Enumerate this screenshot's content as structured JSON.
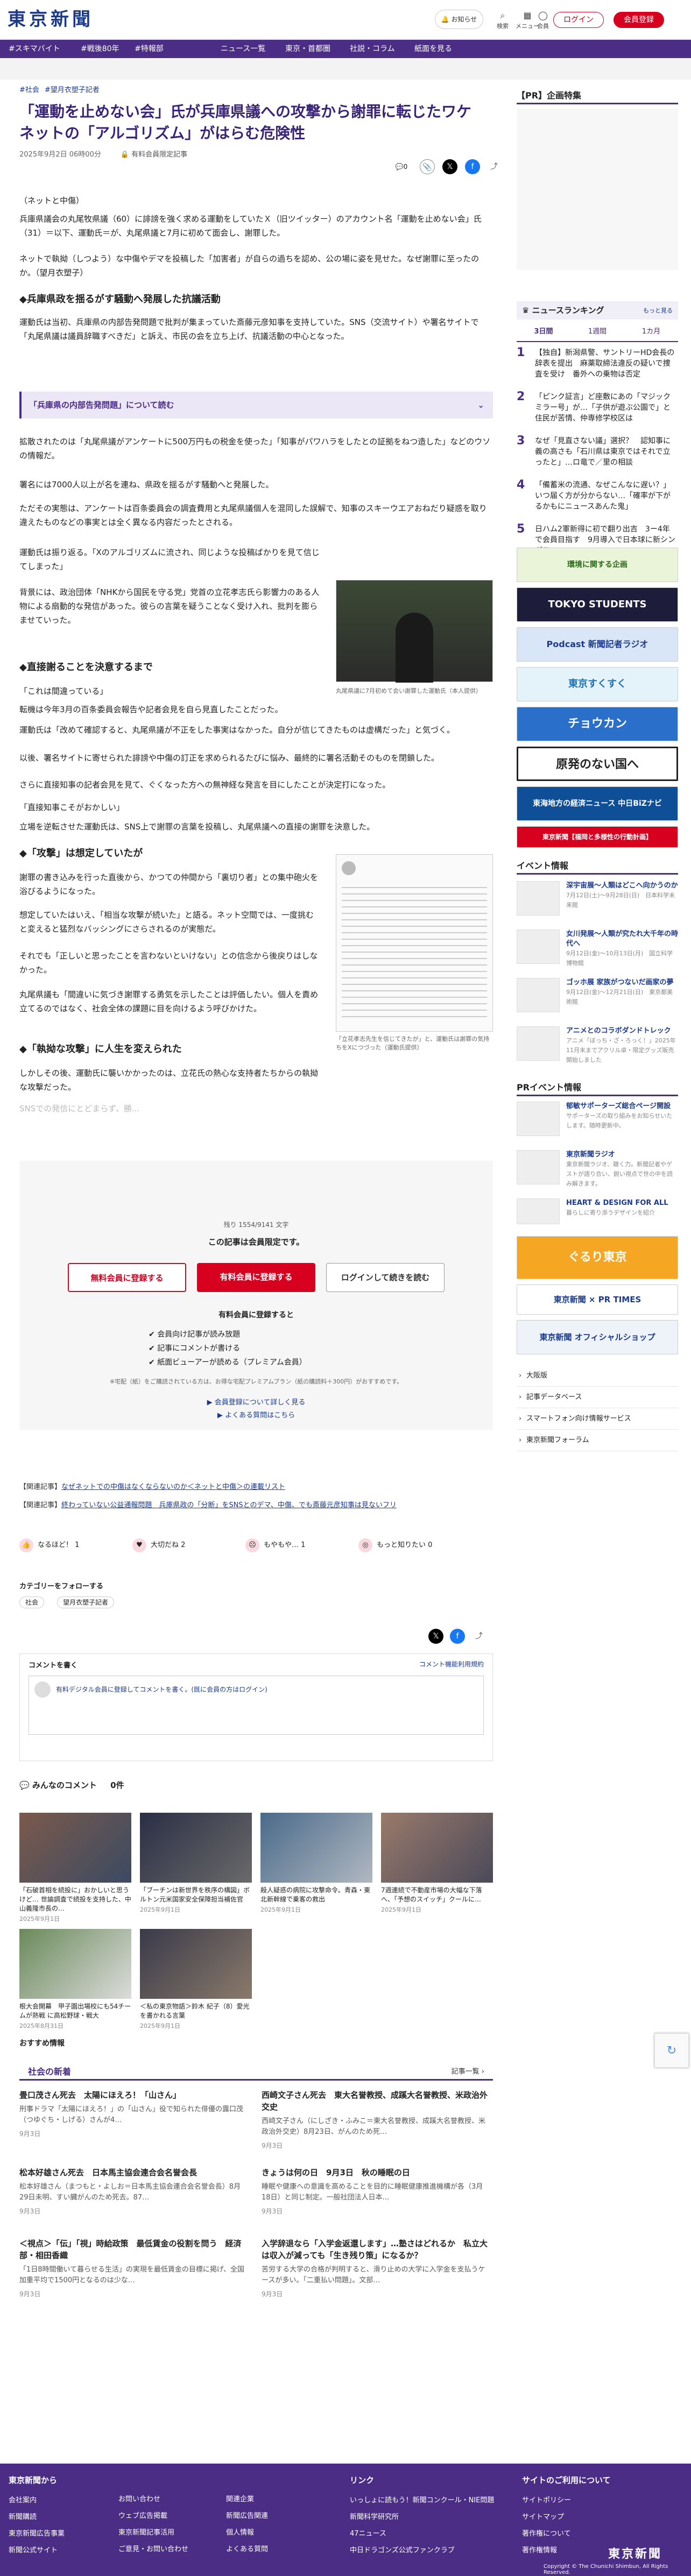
{
  "header": {
    "logo": "東京新聞",
    "news_btn": "お知らせ",
    "icons": [
      {
        "name": "search-icon",
        "glyph": "⌕",
        "label": "検索"
      },
      {
        "name": "grid-icon",
        "glyph": "▦",
        "label": "メニュー"
      },
      {
        "name": "user-icon",
        "glyph": "◯",
        "label": "会員"
      }
    ],
    "login": "ログイン",
    "register": "会員登録"
  },
  "nav": [
    "#スキマバイト",
    "#戦後80年",
    "#特報部",
    "ニュース一覧",
    "東京・首都圏",
    "社説・コラム",
    "紙面を見る"
  ],
  "crumbs": [
    "#社会",
    "#望月衣塑子記者"
  ],
  "article": {
    "title": "「運動を止めない会」氏が兵庫県議への攻撃から謝罪に転じたワケ　ネットの「アルゴリズム」がはらむ危険性",
    "date": "2025年9月2日 06時00分",
    "tag": "有料会員限定記事",
    "comments": "0",
    "source": "（ネットと中傷）",
    "p1": "兵庫県議会の丸尾牧県議（60）に誹謗を強く求める運動をしていたＸ（旧ツイッター）のアカウント名「運動を止めない会」氏（31）＝以下、運動氏＝が、丸尾県議と7月に初めて面会し、謝罪した。",
    "p2": "ネットで執拗（しつよう）な中傷やデマを投稿した「加害者」が自らの過ちを認め、公の場に姿を見せた。なぜ謝罪に至ったのか。（望月衣塑子）",
    "h1": "◆兵庫県政を揺るがす騒動へ発展した抗議活動",
    "p3": "運動氏は当初、兵庫県の内部告発問題で批判が集まっていた斎藤元彦知事を支持していた。SNS（交流サイト）や署名サイトで「丸尾県議は議員辞職すべきだ」と訴え、市民の会を立ち上げ、抗議活動の中心となった。",
    "related_box": "「兵庫県の内部告発問題」について読む",
    "p4": "拡散されたのは「丸尾県議がアンケートに500万円もの税金を使った」「知事がパワハラをしたとの証拠をねつ造した」などのウソの情報だ。",
    "p5": "署名には7000人以上が名を連ね、県政を揺るがす騒動へと発展した。",
    "p6": "ただその実態は、アンケートは百条委員会の調査費用と丸尾県議個人を混同した誤解で、知事のスキーウエアおねだり疑惑を取り違えたものなどの事実とは全く異なる内容だったとされる。",
    "p7": "運動氏は振り返る。「Xのアルゴリズムに流され、同じような投稿ばかりを見て信じてしまった」",
    "p8": "背景には、政治団体「NHKから国民を守る党」党首の立花孝志氏ら影響力のある人物による扇動的な発信があった。彼らの言葉を疑うことなく受け入れ、批判を膨らませていった。",
    "photo1_caption": "丸尾県議に7月初めて会い謝罪した運動氏（本人提供）",
    "h2": "◆直接謝ることを決意するまで",
    "p9": "「これは間違っている」",
    "p10": "転機は今年3月の百条委員会報告や記者会見を自ら見直したことだった。",
    "p11": "運動氏は「改めて確認すると、丸尾県議が不正をした事実はなかった。自分が信じてきたものは虚構だった」と気づく。",
    "p12": "以後、署名サイトに寄せられた誹謗や中傷の訂正を求められるたびに悩み、最終的に署名活動そのものを閉鎖した。",
    "p13": "さらに直接知事の記者会見を見て、ぐくなった方への無神経な発言を目にしたことが決定打になった。",
    "p14": "「直接知事こそがおかしい」",
    "p15": "立場を逆転させた運動氏は、SNS上で謝罪の言葉を投稿し、丸尾県議への直接の謝罪を決意した。",
    "h3": "◆「攻撃」は想定していたが",
    "p16": "謝罪の書き込みを行った直後から、かつての仲間から「裏切り者」との集中砲火を浴びるようになった。",
    "p17": "想定していたはいえ、「相当な攻撃が続いた」と語る。ネット空間では、一度挑むと変えると猛烈なバッシングにさらされるのが実態だ。",
    "p18": "それでも「正しいと思ったことを言わないといけない」との信念から後戻りはしなかった。",
    "p19": "丸尾県議も「間違いに気づき謝罪する勇気を示したことは評価したい。個人を責め立てるのではなく、社会全体の課題に目を向けるよう呼びかけた。",
    "photo2_caption": "「立花孝志先生を信じてきたが」と、運動氏は謝罪の気持ちをXにつづった（運動氏提供）",
    "h4": "◆「執拗な攻撃」に人生を変えられた",
    "p20": "しかしその後、運動氏に襲いかかったのは、立花氏の熱心な支持者たちからの執拗な攻撃だった。",
    "fade": "SNSでの発信にとどまらず、勝..."
  },
  "paywall": {
    "remaining": "残り 1554/9141 文字",
    "members_only": "この記事は会員限定です。",
    "btn_free": "無料会員に登録する",
    "btn_paid": "有料会員に登録する",
    "btn_login": "ログインして続きを読む",
    "benefit_title": "有料会員に登録すると",
    "benefits": [
      "会員向け記事が読み放題",
      "記事にコメントが書ける",
      "紙面ビューアーが読める（プレミアム会員）"
    ],
    "note": "※宅配（紙）をご購読されている方は、お得な宅配プレミアムプラン（紙の購読料＋300円）がおすすめです。",
    "link1": "会員登録について詳しく見る",
    "link2": "よくある質問はこちら"
  },
  "feedback": [
    {
      "label": "【関連記事】",
      "text": "なぜネットでの中傷はなくならないのか＜ネットと中傷＞の連載リスト"
    },
    {
      "label": "【関連記事】",
      "text": "終わっていない公益通報問題　兵庫県政の「分断」をSNSとのデマ、中傷、でも斎藤元彦知事は見ないフリ"
    }
  ],
  "reactions": [
    {
      "icon": "thumb-icon",
      "glyph": "👍",
      "label": "なるほど！",
      "count": "1"
    },
    {
      "icon": "heart-icon",
      "glyph": "♥",
      "label": "大切だね",
      "count": "2"
    },
    {
      "icon": "sad-icon",
      "glyph": "☹",
      "label": "もやもや…",
      "count": "1"
    },
    {
      "icon": "more-icon",
      "glyph": "◎",
      "label": "もっと知りたい",
      "count": "0"
    }
  ],
  "follow": {
    "title": "カテゴリーをフォローする",
    "tags": [
      "社会",
      "望月衣塑子記者"
    ]
  },
  "comment": {
    "title": "コメントを書く",
    "rule_link": "コメント機能利用規約",
    "placeholder": "有料デジタル会員に登録してコメントを書く。(既に会員の方はログイン)"
  },
  "comment_list": {
    "title": "みんなのコメント",
    "count": "0件"
  },
  "related": [
    {
      "t": "「石破首相を続投に」おかしいと思うけど… 世論調査で続投を支持した、中山義隆市長の…",
      "d": "2025年9月1日"
    },
    {
      "t": "「ブーチンは新世界を秩序の構図」ボルトン元米国家安全保障担当補佐官",
      "d": "2025年9月1日"
    },
    {
      "t": "殺人疑惑の病院に攻撃命令。青森・東北新幹線で乗客の救出",
      "d": "2025年9月1日"
    },
    {
      "t": "7週連続で不動産市場の大幅な下落へ、「予想のスイッチ」クールに…",
      "d": "2025年9月1日"
    },
    {
      "t": "根大会開幕　甲子園出場校にも54チームが熱戦 に高松野球・戦大",
      "d": "2025年8月31日"
    },
    {
      "t": "＜私の東京物語＞鈴木 紀子（8）愛光を書かれる言葉",
      "d": "2025年9月1日"
    }
  ],
  "recommend": "おすすめ情報",
  "society": {
    "title": "社会の新着",
    "more": "記事一覧",
    "items": [
      {
        "t": "畳口茂さん死去　太陽にほえろ！「山さん」",
        "s": "刑事ドラマ「太陽にほえろ！」の「山さん」役で知られた俳優の露口茂（つゆぐち・しげる）さんが4…",
        "d": "9月3日"
      },
      {
        "t": "西崎文子さん死去　東大名誉教授、成蹊大名誉教授、米政治外交史",
        "s": "西崎文子さん（にしざき・ふみこ＝東大名誉教授、成蹊大名誉教授、米政治外交史）8月23日、がんのため死…",
        "d": "9月3日"
      },
      {
        "t": "松本好雄さん死去　日本馬主協会連合会名誉会長",
        "s": "松本好雄さん（まつもと・よしお＝日本馬主協会連合会名誉会長）8月29日未明、すい臓がんのため死去。87…",
        "d": "9月3日"
      },
      {
        "t": "きょうは何の日　9月3日　秋の睡眠の日",
        "s": "睡眠や健康への意識を高めることを目的に睡眠健康推進機構が各（3月18日）と同じ制定。一般社団法人日本…",
        "d": "9月3日"
      },
      {
        "t": "＜視点＞「伝」「視」時給政策　最低賃金の役割を問う　経済部・相田香織",
        "s": "「1日8時間働いて暮らせる生活」の実現を最低賃金の目標に掲げ、全国加重平均で1500円となるのは少な…",
        "d": "9月3日"
      },
      {
        "t": "入学辞退なら「入学金返還します」…塾さはどれるか　私立大は収入が減っても「生き残り策」になるか？",
        "s": "苦労する大学の合格が判明すると、滑り止めの大学に入学金を支払うケースが多い。「二重払い問題」。文部…",
        "d": "9月3日"
      }
    ]
  },
  "sidebar": {
    "pr_title": "【PR】企画特集",
    "ranking_title": "ニュースランキング",
    "ranking_more": "もっと見る",
    "ranking_tabs": [
      "3日間",
      "1週間",
      "1カ月"
    ],
    "ranking": [
      {
        "n": "1",
        "t": "【独自】新潟県警、サントリーHD会長の辞表を提出　麻薬取締法違反の疑いで捜査を受け　番外への乗物は否定"
      },
      {
        "n": "2",
        "t": "「ピンク証言」ど座敷にあの「マジックミラー号」が…「子供が遊ぶ公園で」と住民が苦情、仲専修学校区は"
      },
      {
        "n": "3",
        "t": "なぜ「見直さない議」選択？　認知事に義の高さも「石川県は東京ではそれで立ったと」…ロ竜で／里の相談"
      },
      {
        "n": "4",
        "t": "「備蓄米の流通、なぜこんなに遅い？」いつ届く方が分からない…「確率が下がるかもにニュースあんた鬼」"
      },
      {
        "n": "5",
        "t": "日ハム2軍新得に初で翻り出吉　3ー4年で会員目指す　9月導入で日本球に新シングル"
      }
    ],
    "banners": [
      {
        "name": "ad-kankyo",
        "t": "環境に関する企画",
        "bg": "#e9f4d8",
        "fg": "#2d6a1a"
      },
      {
        "name": "ad-students",
        "t": "TOKYO STUDENTS",
        "bg": "#1d1d3b",
        "fg": "#ffffff"
      },
      {
        "name": "ad-podcast",
        "t": "Podcast 新聞記者ラジオ",
        "bg": "#d9e6f7",
        "fg": "#1b3a8c"
      },
      {
        "name": "ad-tokyo-kurasu",
        "t": "東京すくすく",
        "bg": "#e4f2f9",
        "fg": "#1b6fb3"
      },
      {
        "name": "ad-chouchoukan",
        "t": "チョウカン",
        "bg": "#2a6fc9",
        "fg": "#ffffff"
      },
      {
        "name": "ad-genpatsu",
        "t": "原発のない国へ",
        "bg": "#ffffff",
        "fg": "#222222"
      },
      {
        "name": "ad-chunichi-biz",
        "t": "東海地方の経済ニュース 中日BiZナビ",
        "bg": "#0e4f97",
        "fg": "#ffffff"
      },
      {
        "name": "ad-shimbun-event",
        "t": "東京新聞【福岡と多様性の行動計画】",
        "bg": "#d7001f",
        "fg": "#ffffff"
      }
    ],
    "event_title": "イベント情報",
    "events": [
      {
        "t": "深宇宙展〜人類はどこへ向かうのか",
        "s": "7月12日(土)〜9月28日(日)　日本科学未来館"
      },
      {
        "t": "女川発展〜人類が究たれ大千年の時代へ",
        "s": "9月12日(金)〜10月13日(月)　国立科学博物館"
      },
      {
        "t": "ゴッホ展 家族がつないだ画家の夢",
        "s": "9月12日(金)〜12月21日(日)　東京都美術館"
      },
      {
        "t": "アニメとのコラボダンドトレック",
        "s": "アニメ「ぼっち・ざ・ろっく！」2025年11月末までアクリル卓・限定グッズ販売開始しました"
      }
    ],
    "prevent_title": "PRイベント情報",
    "prevents": [
      {
        "t": "郁敏サポーターズ総合ページ開設",
        "s": "サポーターズの取り組みをお知らせいたします。随時更新中。"
      },
      {
        "t": "東京新聞ラジオ",
        "s": "東京新聞ラジオ、聴く力。新聞記者やゲストが語り合い、鋭い視点で世の中を読み解きます。"
      },
      {
        "t": "HEART & DESIGN FOR ALL",
        "s": "暮らしに寄り添うデザインを紹介"
      }
    ],
    "shop": [
      "ぐるり東京",
      "東京新聞 × PR TIMES",
      "東京新聞 オフィシャルショップ"
    ],
    "links": [
      "大阪版",
      "記事データベース",
      "スマートフォン向け情報サービス",
      "東京新聞フォーラム"
    ]
  },
  "footer": {
    "col1_title": "東京新聞から",
    "col1": [
      "会社案内",
      "新聞購読",
      "東京新聞広告事業",
      "新聞公式サイト"
    ],
    "col2": [
      "お問い合わせ",
      "ウェブ広告掲載",
      "東京新聞記事活用",
      "ご意見・お問い合わせ"
    ],
    "col3": [
      "関連企業",
      "新聞広告関連",
      "個人情報",
      "よくある質問"
    ],
    "col4_title": "リンク",
    "col4": [
      "いっしょに読もう！新聞コンクール・NIE問題",
      "新聞科学研究所",
      "47ニュース",
      "中日ドラゴンズ公式ファンクラブ"
    ],
    "col5_title": "サイトのご利用について",
    "col5": [
      "サイトポリシー",
      "サイトマップ",
      "著作権について",
      "著作権情報"
    ],
    "copyright": "Copyright © The Chunichi Shimbun, All Rights Reserved.",
    "logo": "東京新聞"
  }
}
